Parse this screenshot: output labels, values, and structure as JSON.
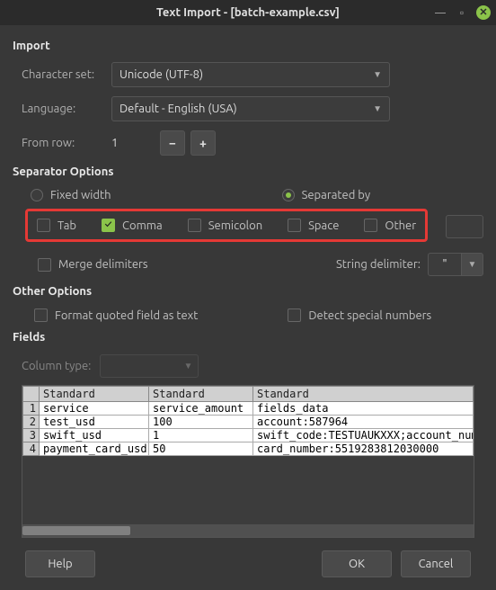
{
  "title": "Text Import - [batch-example.csv]",
  "sections": {
    "import": "Import",
    "separator": "Separator Options",
    "other": "Other Options",
    "fields": "Fields"
  },
  "import": {
    "charset_label": "Character set:",
    "charset_value": "Unicode (UTF-8)",
    "language_label": "Language:",
    "language_value": "Default - English (USA)",
    "fromrow_label": "From row:",
    "fromrow_value": "1"
  },
  "separator": {
    "fixed_label": "Fixed width",
    "separated_label": "Separated by",
    "separated_selected": true,
    "tab": "Tab",
    "comma": "Comma",
    "semicolon": "Semicolon",
    "space": "Space",
    "other": "Other",
    "comma_checked": true,
    "merge_label": "Merge delimiters",
    "string_delim_label": "String delimiter:",
    "string_delim_value": "\""
  },
  "other_opts": {
    "quoted_label": "Format quoted field as text",
    "detect_label": "Detect special numbers"
  },
  "fields": {
    "coltype_label": "Column type:",
    "headers": [
      "Standard",
      "Standard",
      "Standard"
    ],
    "rows": [
      [
        "service",
        "service_amount",
        "fields_data"
      ],
      [
        "test_usd",
        "100",
        "account:587964"
      ],
      [
        "swift_usd",
        "1",
        "swift_code:TESTUAUKXXX;account_number"
      ],
      [
        "payment_card_usd",
        "50",
        "card_number:5519283812030000"
      ]
    ]
  },
  "buttons": {
    "help": "Help",
    "ok": "OK",
    "cancel": "Cancel"
  }
}
